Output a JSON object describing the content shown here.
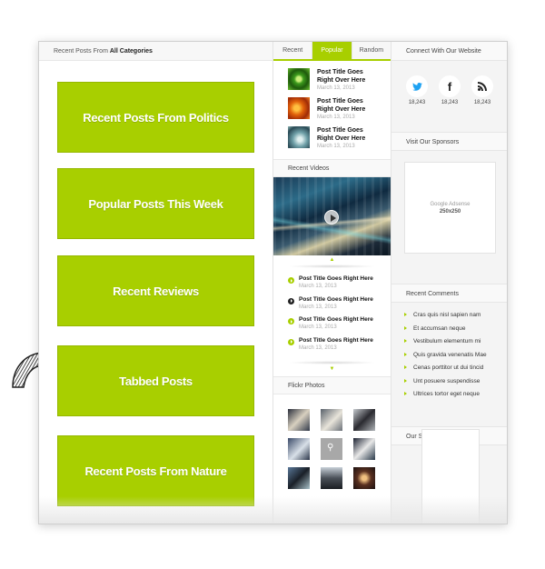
{
  "main": {
    "header_prefix": "Recent Posts From",
    "header_bold": "All Categories",
    "boxes": [
      {
        "label": "Recent Posts From Politics"
      },
      {
        "label": "Popular Posts This Week"
      },
      {
        "label": "Recent Reviews"
      },
      {
        "label": "Tabbed Posts"
      },
      {
        "label": "Recent Posts From Nature"
      }
    ]
  },
  "tabs": {
    "items": [
      {
        "label": "Recent",
        "active": false
      },
      {
        "label": "Popular",
        "active": true
      },
      {
        "label": "Random",
        "active": false
      }
    ],
    "posts": [
      {
        "title_line1": "Post Title Goes",
        "title_line2": "Right Over Here",
        "date": "March 13, 2013",
        "thumb": "green-plant"
      },
      {
        "title_line1": "Post Title Goes",
        "title_line2": "Right Over Here",
        "date": "March 13, 2013",
        "thumb": "orange-leaves"
      },
      {
        "title_line1": "Post Title Goes",
        "title_line2": "Right Over Here",
        "date": "March 13, 2013",
        "thumb": "teal-water"
      }
    ]
  },
  "videos": {
    "title": "Recent Videos",
    "list": [
      {
        "title": "Post Title Goes Right Here",
        "date": "March 13, 2013",
        "active": false
      },
      {
        "title": "Post Title Goes Right Here",
        "date": "March 13, 2013",
        "active": true
      },
      {
        "title": "Post Title Goes Right Here",
        "date": "March 13, 2013",
        "active": false
      },
      {
        "title": "Post Title Goes Right Here",
        "date": "March 13, 2013",
        "active": false
      }
    ]
  },
  "flickr": {
    "title": "Flickr Photos",
    "photo_count": 9
  },
  "sidebar": {
    "connect_title": "Connect With Our Website",
    "social": [
      {
        "icon": "twitter-icon",
        "count": "18,243",
        "color": "#1da1f2"
      },
      {
        "icon": "facebook-icon",
        "count": "18,243",
        "color": "#222222"
      },
      {
        "icon": "rss-icon",
        "count": "18,243",
        "color": "#222222"
      }
    ],
    "sponsors_title": "Visit Our Sponsors",
    "ad_line1": "Google Adsense",
    "ad_line2": "250x250",
    "comments_title": "Recent Comments",
    "comments": [
      "Cras quis nisl sapien nam",
      "Et accumsan neque",
      "Vestibulum elementum mi",
      "Quis gravida venenatis Mae",
      "Cenas porttitor ut dui tincid",
      "Unt posuere suspendisse",
      "Ultrices tortor eget neque"
    ],
    "our_sponsors_title": "Our Sponsors"
  },
  "colors": {
    "accent": "#a8cf00",
    "twitter": "#1da1f2"
  }
}
